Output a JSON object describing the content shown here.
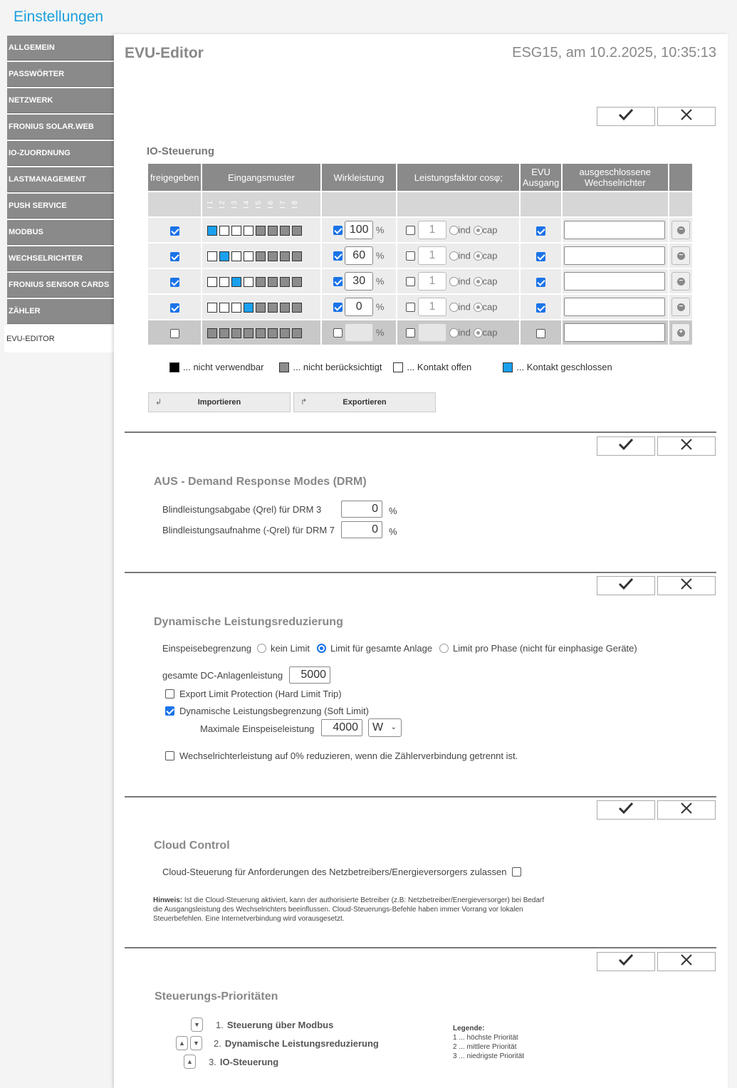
{
  "app_title": "Einstellungen",
  "sidebar": {
    "items": [
      {
        "label": "ALLGEMEIN"
      },
      {
        "label": "PASSWÖRTER"
      },
      {
        "label": "NETZWERK"
      },
      {
        "label": "FRONIUS SOLAR.WEB"
      },
      {
        "label": "IO-ZUORDNUNG"
      },
      {
        "label": "LASTMANAGEMENT"
      },
      {
        "label": "PUSH SERVICE"
      },
      {
        "label": "MODBUS"
      },
      {
        "label": "WECHSELRICHTER"
      },
      {
        "label": "FRONIUS SENSOR CARDS"
      },
      {
        "label": "ZÄHLER"
      },
      {
        "label": "EVU-EDITOR"
      }
    ],
    "active_index": 11
  },
  "header": {
    "title": "EVU-Editor",
    "subtitle": "ESG15, am 10.2.2025, 10:35:13"
  },
  "icons": {
    "confirm": "check-icon",
    "cancel": "close-icon",
    "remove": "minus-circle-icon",
    "add": "plus-circle-icon"
  },
  "io": {
    "title": "IO-Steuerung",
    "headers": {
      "enabled": "freigegeben",
      "pattern": "Eingangsmuster",
      "power": "Wirkleistung",
      "cosphi": "Leistungsfaktor cosφ;",
      "evu1": "EVU",
      "evu2": "Ausgang",
      "excluded1": "ausgeschlossene",
      "excluded2": "Wechselrichter"
    },
    "pin_labels": [
      "I 1",
      "I 2",
      "I 3",
      "I 4",
      "I 5",
      "I 6",
      "I 7",
      "I 8"
    ],
    "percent": "%",
    "ind": "ind",
    "cap": "cap",
    "rows": [
      {
        "enabled": true,
        "pattern": [
          "b",
          "w",
          "w",
          "w",
          "g",
          "g",
          "g",
          "g"
        ],
        "power_on": true,
        "power": "100",
        "cos_on": false,
        "cos": "1",
        "evu": true
      },
      {
        "enabled": true,
        "pattern": [
          "w",
          "b",
          "w",
          "w",
          "g",
          "g",
          "g",
          "g"
        ],
        "power_on": true,
        "power": "60",
        "cos_on": false,
        "cos": "1",
        "evu": true
      },
      {
        "enabled": true,
        "pattern": [
          "w",
          "w",
          "b",
          "w",
          "g",
          "g",
          "g",
          "g"
        ],
        "power_on": true,
        "power": "30",
        "cos_on": false,
        "cos": "1",
        "evu": true
      },
      {
        "enabled": true,
        "pattern": [
          "w",
          "w",
          "w",
          "b",
          "g",
          "g",
          "g",
          "g"
        ],
        "power_on": true,
        "power": "0",
        "cos_on": false,
        "cos": "1",
        "evu": true
      },
      {
        "enabled": false,
        "pattern": [
          "g",
          "g",
          "g",
          "g",
          "g",
          "g",
          "g",
          "g"
        ],
        "power_on": false,
        "power": "",
        "cos_on": false,
        "cos": "",
        "evu": false
      }
    ],
    "legend": {
      "unusable": "... nicht verwendbar",
      "ignored": "... nicht berücksichtigt",
      "open": "... Kontakt offen",
      "closed": "... Kontakt geschlossen"
    },
    "import_label": "Importieren",
    "export_label": "Exportieren"
  },
  "drm": {
    "title": "AUS - Demand Response Modes (DRM)",
    "qrel_label": "Blindleistungsabgabe (Qrel) für DRM 3",
    "qrel_value": "0",
    "nqrel_label": "Blindleistungsaufnahme (-Qrel) für DRM 7",
    "nqrel_value": "0",
    "unit": "%"
  },
  "dyn": {
    "title": "Dynamische Leistungsreduzierung",
    "feed_label": "Einspeisebegrenzung",
    "opt_none": "kein Limit",
    "opt_total": "Limit für gesamte Anlage",
    "opt_phase": "Limit pro Phase (nicht für einphasige Geräte)",
    "selected": "total",
    "dc_label": "gesamte DC-Anlagenleistung",
    "dc_value": "5000",
    "hard_label": "Export Limit Protection (Hard Limit Trip)",
    "hard_on": false,
    "soft_label": "Dynamische Leistungsbegrenzung (Soft Limit)",
    "soft_on": true,
    "max_label": "Maximale Einspeiseleistung",
    "max_value": "4000",
    "max_unit": "W",
    "meter_label": "Wechselrichterleistung auf 0% reduzieren, wenn die Zählerverbindung getrennt ist.",
    "meter_on": false
  },
  "cloud": {
    "title": "Cloud Control",
    "allow_label": "Cloud-Steuerung für Anforderungen des Netzbetreibers/Energieversorgers zulassen",
    "allow_on": false,
    "hint_bold": "Hinweis:",
    "hint_text": " Ist die Cloud-Steuerung aktiviert, kann der authorisierte Betreiber (z.B: Netzbetreiber/Energieversorger) bei Bedarf die Ausgangsleistung des Wechselrichters beeinflussen. Cloud-Steuerungs-Befehle haben immer Vorrang vor lokalen Steuerbefehlen. Eine Internetverbindung wird vorausgesetzt."
  },
  "prio": {
    "title": "Steuerungs-Prioritäten",
    "items": [
      {
        "num": "1.",
        "label": "Steuerung über Modbus"
      },
      {
        "num": "2.",
        "label": "Dynamische Leistungsreduzierung"
      },
      {
        "num": "3.",
        "label": "IO-Steuerung"
      }
    ],
    "legend_title": "Legende:",
    "legend_items": [
      "1 ... höchste Priorität",
      "2 ... mittlere Priorität",
      "3 ... niedrigste Priorität"
    ]
  }
}
